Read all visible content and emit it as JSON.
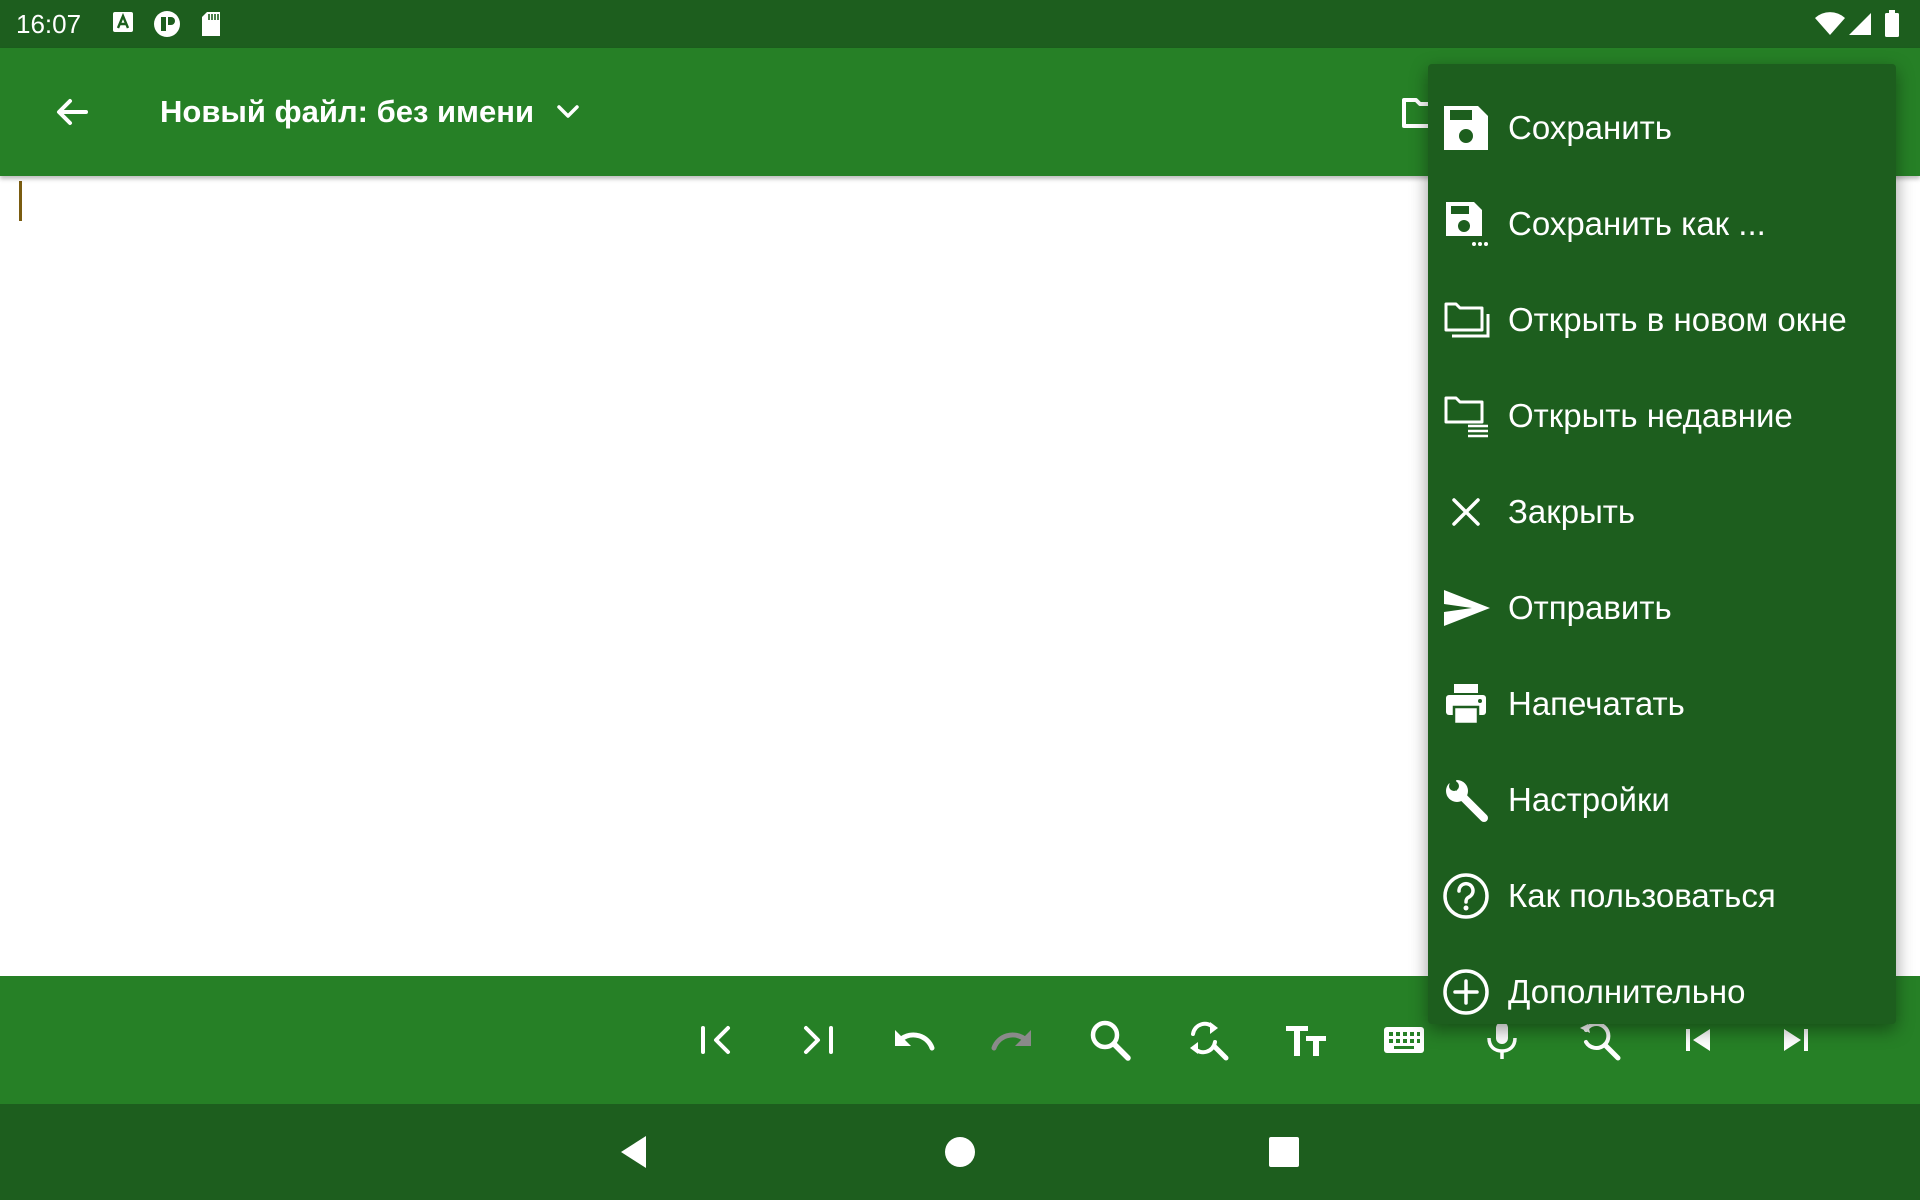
{
  "status_bar": {
    "time": "16:07",
    "left_icons": [
      "a-notification-icon",
      "app-notification-icon",
      "sd-card-icon"
    ],
    "right_icons": [
      "wifi-icon",
      "signal-icon",
      "battery-icon"
    ]
  },
  "app_bar": {
    "title": "Новый файл: без имени",
    "icons": [
      "back-arrow-icon",
      "chevron-down-icon",
      "folder-icon"
    ]
  },
  "editor": {
    "text": ""
  },
  "menu": {
    "items": [
      {
        "label": "Сохранить",
        "icon": "save-icon"
      },
      {
        "label": "Сохранить как ...",
        "icon": "save-as-icon"
      },
      {
        "label": "Открыть в новом окне",
        "icon": "open-new-window-icon"
      },
      {
        "label": "Открыть недавние",
        "icon": "recent-files-icon"
      },
      {
        "label": "Закрыть",
        "icon": "close-icon"
      },
      {
        "label": "Отправить",
        "icon": "send-icon"
      },
      {
        "label": "Напечатать",
        "icon": "print-icon"
      },
      {
        "label": "Настройки",
        "icon": "wrench-icon"
      },
      {
        "label": "Как пользоваться",
        "icon": "help-icon"
      },
      {
        "label": "Дополнительно",
        "icon": "add-circle-icon"
      }
    ]
  },
  "bottom_toolbar": {
    "tools": [
      "line-start-icon",
      "line-end-icon",
      "undo-icon",
      "redo-icon",
      "search-icon",
      "search-replace-icon",
      "text-size-icon",
      "keyboard-icon",
      "microphone-icon",
      "zoom-icon",
      "file-start-icon",
      "file-end-icon"
    ],
    "redo_enabled": false
  },
  "nav_bar": {
    "icons": [
      "nav-back-icon",
      "nav-home-icon",
      "nav-recents-icon"
    ]
  },
  "colors": {
    "status_bar": "#1d5e1e",
    "app_bar": "#268026",
    "menu_bg": "#1d5e1e",
    "cursor": "#7a5c10",
    "disabled_icon": "#8a8a8a"
  }
}
